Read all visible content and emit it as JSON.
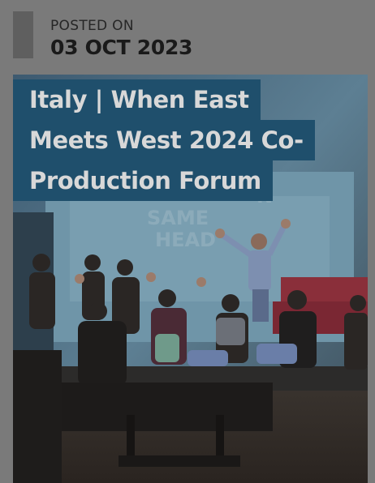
{
  "post": {
    "posted_on_label": "POSTED ON",
    "date": "03 OCT 2023"
  },
  "article": {
    "title_lines": [
      "Italy | When East",
      "Meets West 2024 Co-",
      "Production Forum"
    ]
  },
  "colors": {
    "page_background": "#7a7a7a",
    "date_accent": "#5f5f5f",
    "title_background": "#1f4f6c",
    "title_text": "#d8d8d8"
  }
}
